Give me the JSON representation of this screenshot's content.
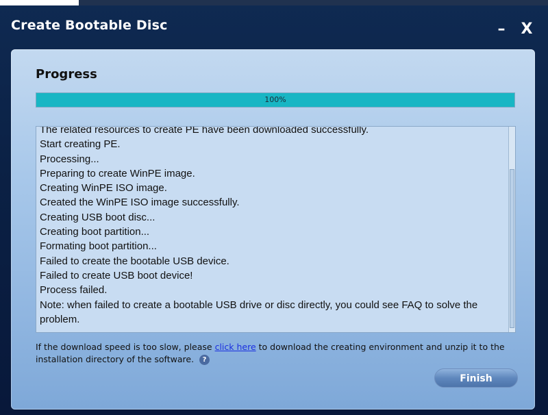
{
  "window": {
    "title": "Create Bootable Disc",
    "minimize_icon": "minimize-icon",
    "close_icon": "close-icon",
    "minimize_glyph": "–",
    "close_glyph": "X"
  },
  "progress": {
    "heading": "Progress",
    "percent_text": "100%",
    "value": 1.0,
    "fill_color": "#18b6c4"
  },
  "log": {
    "lines": [
      "The related resources to create PE have been downloaded successfully.",
      "Start creating PE.",
      "Processing...",
      "Preparing to create WinPE image.",
      "Creating WinPE ISO image.",
      "Created the WinPE ISO image successfully.",
      "Creating USB boot disc...",
      "Creating boot partition...",
      "Formating boot partition...",
      "Failed to create the bootable USB device.",
      "Failed to create USB boot device!",
      "Process failed.",
      "Note: when failed to create a bootable USB drive or disc directly, you could see FAQ to solve the problem."
    ]
  },
  "note": {
    "before_link": "If the download speed is too slow, please ",
    "link": "click here",
    "after_link": " to download the creating environment and unzip it to the installation directory of the software.",
    "help_icon": "question-icon",
    "help_glyph": "?"
  },
  "buttons": {
    "finish": "Finish"
  }
}
